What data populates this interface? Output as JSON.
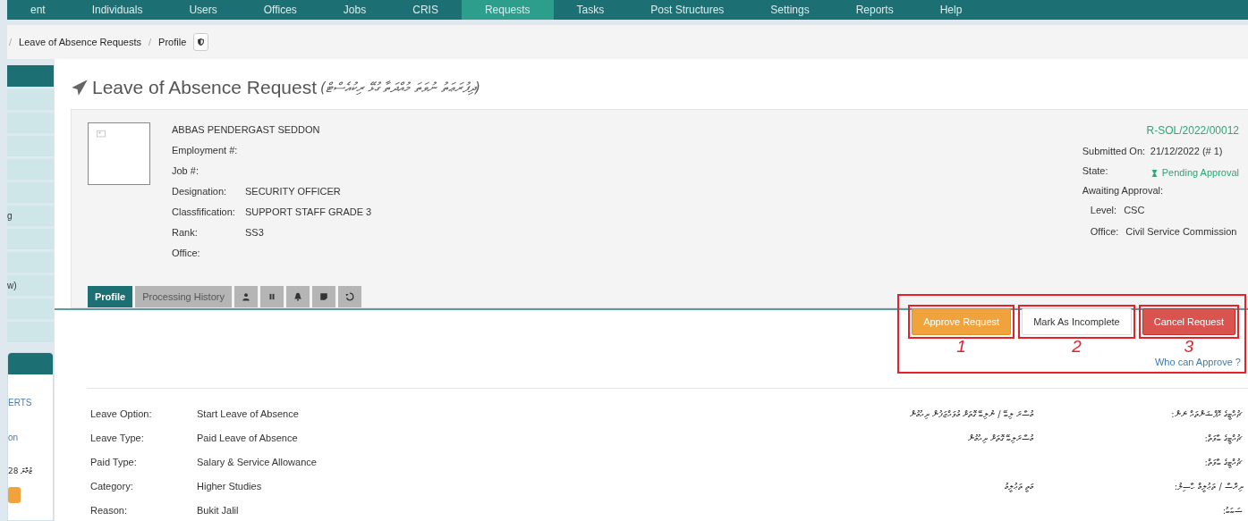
{
  "nav": {
    "items": [
      {
        "label": "ent",
        "selected": false
      },
      {
        "label": "Individuals",
        "selected": false
      },
      {
        "label": "Users",
        "selected": false
      },
      {
        "label": "Offices",
        "selected": false
      },
      {
        "label": "Jobs",
        "selected": false
      },
      {
        "label": "CRIS",
        "selected": false
      },
      {
        "label": "Requests",
        "selected": true
      },
      {
        "label": "Tasks",
        "selected": false
      },
      {
        "label": "Post Structures",
        "selected": false
      },
      {
        "label": "Settings",
        "selected": false
      },
      {
        "label": "Reports",
        "selected": false
      },
      {
        "label": "Help",
        "selected": false
      }
    ]
  },
  "breadcrumb": [
    {
      "kind": "sep",
      "text": "/"
    },
    {
      "kind": "crumb",
      "text": "Leave of Absence Requests"
    },
    {
      "kind": "sep",
      "text": "/"
    },
    {
      "kind": "crumb",
      "text": "Profile"
    }
  ],
  "sidebar": {
    "items": [
      {
        "label": "g"
      },
      {
        "label": "w)"
      }
    ],
    "panel": {
      "lines": [
        {
          "kind": "link",
          "text": "ERTS"
        },
        {
          "kind": "link",
          "text": "on"
        },
        {
          "kind": "text",
          "text": "ޖުމްލަ 28"
        }
      ]
    }
  },
  "title": {
    "text": "Leave of Absence Request",
    "dhivehi": "(ދިފުރަޢަތު ނުވަތަ މުއްދަތާ ގުޅޭ ރިކުއެސްޓް)"
  },
  "person": {
    "name": "ABBAS PENDERGAST SEDDON",
    "fields": [
      {
        "label": "Employment #:"
      },
      {
        "label": "Job #:"
      },
      {
        "label": "Designation:",
        "value": "SECURITY OFFICER"
      },
      {
        "label": "Classfification:",
        "value": "SUPPORT STAFF GRADE 3"
      },
      {
        "label": "Rank:",
        "value": "SS3"
      },
      {
        "label": "Office:"
      }
    ]
  },
  "request": {
    "number": "R-SOL/2022/00012",
    "rows": [
      {
        "label": "Submitted On:",
        "value": "21/12/2022 (# 1)",
        "kind": "text"
      },
      {
        "label": "State:",
        "value": "Pending Approval",
        "kind": "status"
      },
      {
        "label": "Awaiting Approval:",
        "kind": "text"
      }
    ],
    "approval": [
      {
        "label": "Level:",
        "value": "CSC"
      },
      {
        "label": "Office:",
        "value": "Civil Service Commission"
      }
    ]
  },
  "tabs": [
    {
      "label": "Profile",
      "selected": true
    },
    {
      "label": "Processing History",
      "selected": false
    }
  ],
  "icon_tabs": [
    {
      "selected": false
    },
    {
      "selected": false
    },
    {
      "selected": false
    },
    {
      "selected": false
    },
    {
      "selected": false
    }
  ],
  "actions": [
    {
      "label": "Approve Request",
      "kind": "warning",
      "note": "1"
    },
    {
      "label": "Mark As Incomplete",
      "kind": "plain",
      "note": "2"
    },
    {
      "label": "Cancel Request",
      "kind": "danger",
      "note": "3"
    }
  ],
  "who_can_approve": "Who can Approve ?",
  "details": [
    {
      "label": "Leave Option:",
      "value": "Start Leave of Absence",
      "dv_label": "ޗުއްޓީގެ އޮޕްޝަންތައް ނަން:",
      "dv_value": "މުސާރަ ލިބޭ / ނުލިބޭ ގޮތަށް މުވައްޒަފުން ދިއުމުން"
    },
    {
      "label": "Leave Type:",
      "value": "Paid Leave of Absence",
      "dv_label": "ޗުއްޓީގެ ބާވަތް:",
      "dv_value": "މުސާރަލިބޭ ގޮތަށް ދިއުމުން"
    },
    {
      "label": "Paid Type:",
      "value": "Salary & Service Allowance",
      "dv_label": "ޗުއްޓީގެ ބާވަތް:"
    },
    {
      "label": "Category:",
      "value": "Higher Studies",
      "dv_label": "ދިރާސާ / ތަޢުލީމް ހާސިލު:",
      "dv_value": "މަތީ ތަޢުލީމު"
    },
    {
      "label": "Reason:",
      "value": "Bukit Jalil",
      "dv_label": "ސަބަބު:"
    }
  ]
}
